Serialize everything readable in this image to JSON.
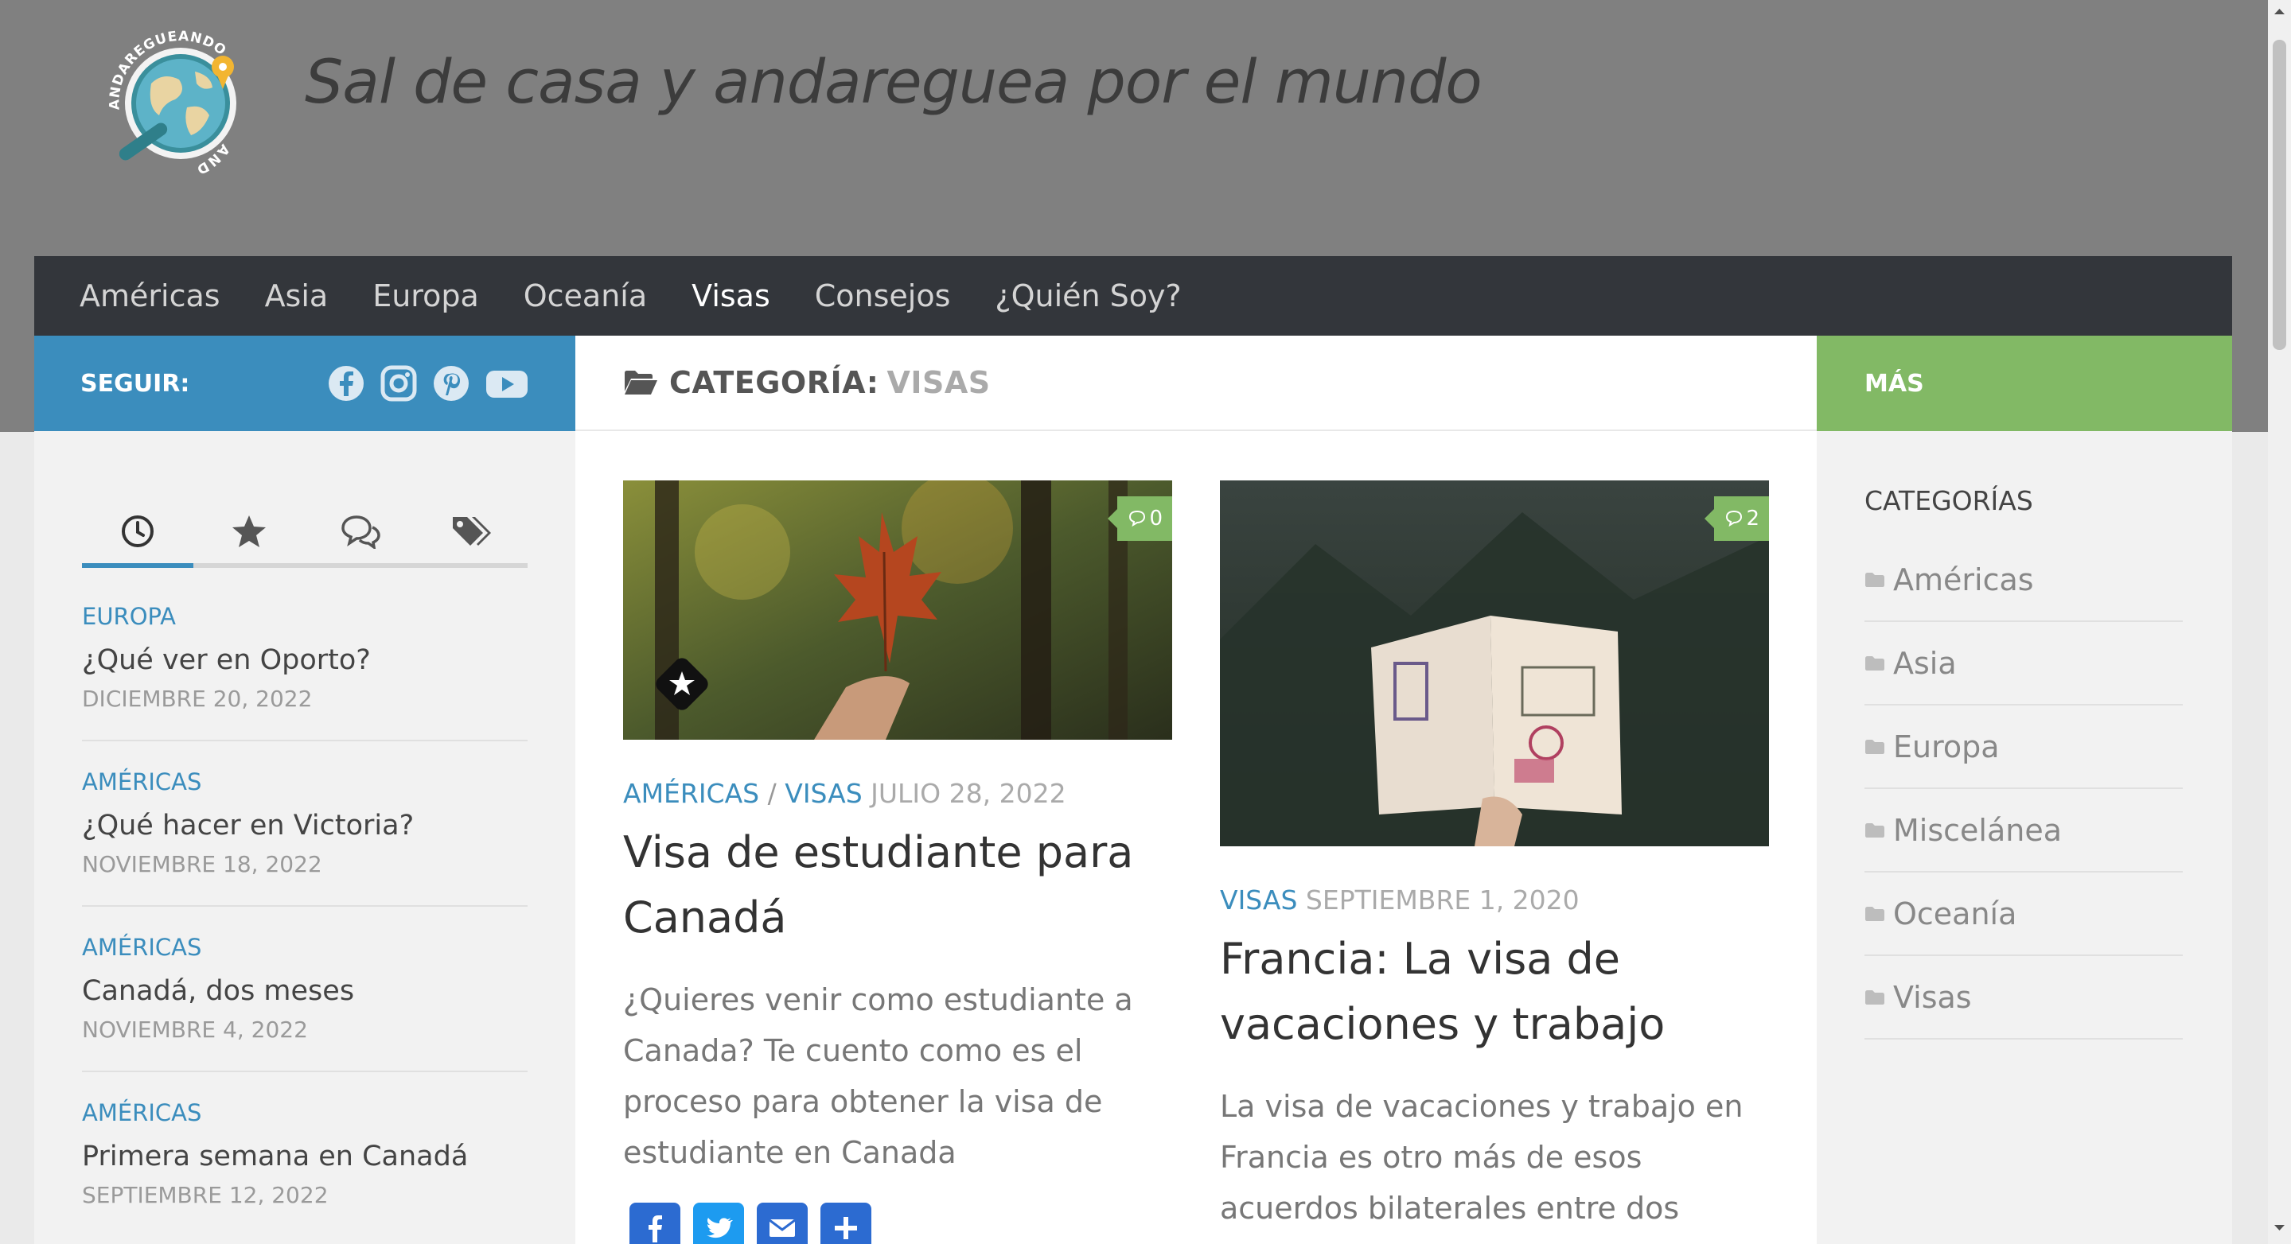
{
  "site": {
    "title": "Sal de casa y andareguea por el mundo",
    "logo_text_top": "ANDAREGUEANDO",
    "logo_text_bottom": "ANDO"
  },
  "nav": {
    "items": [
      "Américas",
      "Asia",
      "Europa",
      "Oceanía",
      "Visas",
      "Consejos",
      "¿Quién Soy?"
    ],
    "active": "Visas"
  },
  "left_sidebar": {
    "follow_label": "SEGUIR:",
    "social_icons": [
      "facebook-icon",
      "instagram-icon",
      "pinterest-icon",
      "youtube-icon"
    ],
    "tabs": [
      "clock-icon",
      "star-icon",
      "comments-icon",
      "tags-icon"
    ],
    "posts": [
      {
        "category": "EUROPA",
        "title": "¿Qué ver en Oporto?",
        "date": "DICIEMBRE 20, 2022"
      },
      {
        "category": "AMÉRICAS",
        "title": "¿Qué hacer en Victoria?",
        "date": "NOVIEMBRE 18, 2022"
      },
      {
        "category": "AMÉRICAS",
        "title": "Canadá, dos meses",
        "date": "NOVIEMBRE 4, 2022"
      },
      {
        "category": "AMÉRICAS",
        "title": "Primera semana en Canadá",
        "date": "SEPTIEMBRE 12, 2022"
      }
    ]
  },
  "main": {
    "heading_label": "CATEGORÍA:",
    "heading_value": "VISAS",
    "articles": [
      {
        "comments": "0",
        "categories": [
          "AMÉRICAS",
          "VISAS"
        ],
        "category_separator": "/",
        "date": "JULIO 28, 2022",
        "title": "Visa de estudiante para Canadá",
        "excerpt": "¿Quieres venir como estudiante a Canada? Te cuento como es el proceso para obtener la visa de estudiante en Canada"
      },
      {
        "comments": "2",
        "categories": [
          "VISAS"
        ],
        "date": "SEPTIEMBRE 1, 2020",
        "title": "Francia: La visa de vacaciones y trabajo",
        "excerpt": "La visa de vacaciones y trabajo en Francia es otro más de esos acuerdos bilaterales entre dos países que permiten"
      }
    ],
    "share_icons": [
      "facebook-share-icon",
      "twitter-share-icon",
      "email-share-icon",
      "plus-share-icon"
    ]
  },
  "right_sidebar": {
    "more_label": "MÁS",
    "categories_heading": "CATEGORÍAS",
    "categories": [
      "Américas",
      "Asia",
      "Europa",
      "Miscelánea",
      "Oceanía",
      "Visas"
    ]
  },
  "colors": {
    "header_gray": "#808080",
    "nav_dark": "#33363b",
    "blue_accent": "#3b8dbd",
    "green_accent": "#82b965"
  }
}
